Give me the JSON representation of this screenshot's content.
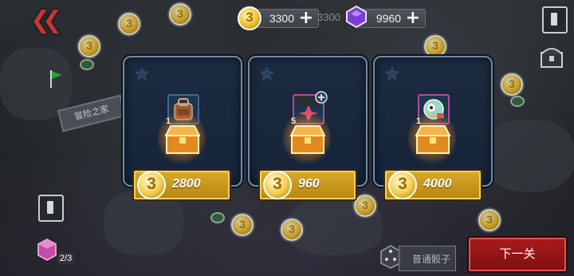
{
  "header": {
    "back_icon": "double-chevron-left-icon",
    "coins": "3300",
    "coins_ghost": "3300",
    "gems": "9960",
    "plus": "+"
  },
  "map": {
    "sign_text": "冒险之家"
  },
  "shop": {
    "cards": [
      {
        "star": "★",
        "quantity": "1",
        "price": "2800"
      },
      {
        "star": "★",
        "quantity": "5",
        "price": "960"
      },
      {
        "star": "★",
        "quantity": "1",
        "price": "4000"
      }
    ]
  },
  "bottom": {
    "dice_count": "2/3",
    "normal_dice": "普通骰子",
    "next_level": "下一关"
  },
  "colors": {
    "gold": "#d6a92a",
    "card_border": "#6e8aa8",
    "next_red": "#a91b1b",
    "gem_purple": "#7b3fd0"
  }
}
